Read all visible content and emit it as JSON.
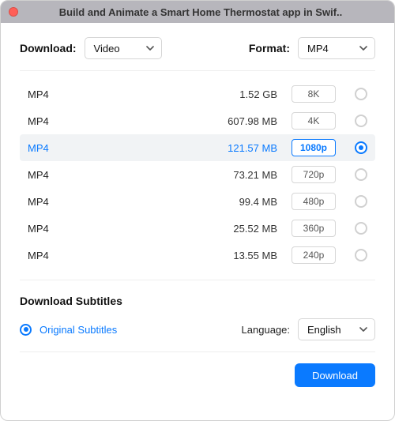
{
  "window": {
    "title": "Build and Animate a Smart Home Thermostat app in Swif.."
  },
  "controls": {
    "download_label": "Download:",
    "download_value": "Video",
    "format_label": "Format:",
    "format_value": "MP4"
  },
  "rows": [
    {
      "format": "MP4",
      "size": "1.52 GB",
      "quality": "8K",
      "selected": false
    },
    {
      "format": "MP4",
      "size": "607.98 MB",
      "quality": "4K",
      "selected": false
    },
    {
      "format": "MP4",
      "size": "121.57 MB",
      "quality": "1080p",
      "selected": true
    },
    {
      "format": "MP4",
      "size": "73.21 MB",
      "quality": "720p",
      "selected": false
    },
    {
      "format": "MP4",
      "size": "99.4 MB",
      "quality": "480p",
      "selected": false
    },
    {
      "format": "MP4",
      "size": "25.52 MB",
      "quality": "360p",
      "selected": false
    },
    {
      "format": "MP4",
      "size": "13.55 MB",
      "quality": "240p",
      "selected": false
    }
  ],
  "subtitles": {
    "heading": "Download Subtitles",
    "option_label": "Original Subtitles",
    "option_selected": true,
    "language_label": "Language:",
    "language_value": "English"
  },
  "footer": {
    "download_button": "Download"
  },
  "colors": {
    "accent": "#0a7aff"
  }
}
